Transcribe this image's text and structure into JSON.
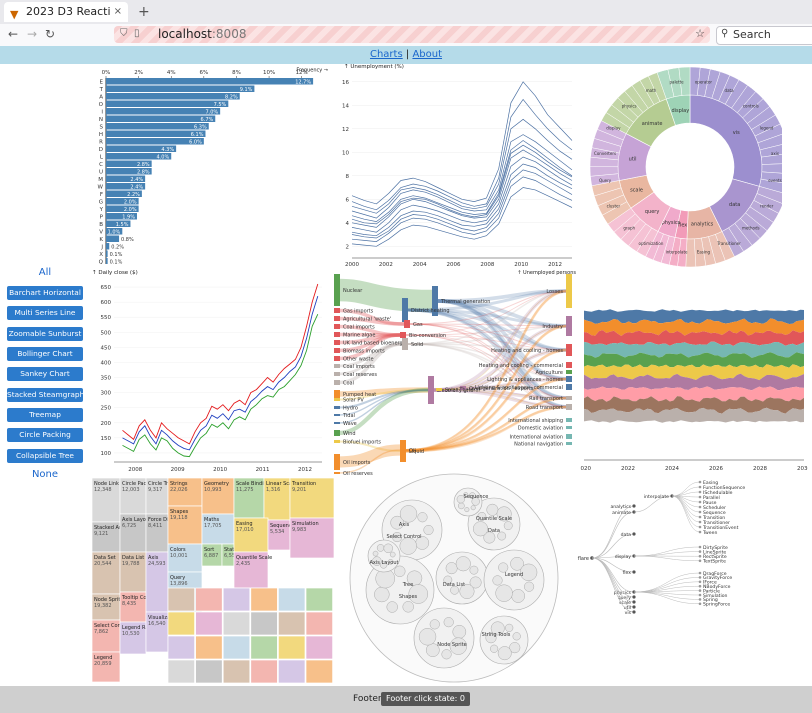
{
  "browser": {
    "tab_title": "2023 D3 Reactive",
    "tab_close": "×",
    "new_tab": "+",
    "url_host": "localhost",
    "url_port": ":8008",
    "search_placeholder": "Search",
    "back_glyph": "←",
    "forward_glyph": "→",
    "reload_glyph": "↻"
  },
  "topnav": {
    "charts_label": "Charts",
    "separator": "|",
    "about_label": "About"
  },
  "sidebar": {
    "all_label": "All",
    "none_label": "None",
    "buttons": [
      "Barchart Horizontal",
      "Multi Series Line",
      "Zoomable Sunburst",
      "Bollinger Chart",
      "Sankey Chart",
      "Stacked Steamgraph",
      "Treemap",
      "Circle Packing",
      "Collapsible Tree"
    ],
    "button_color": "#2c7bcc"
  },
  "footer": {
    "label": "Footer",
    "state_text": "Footer click state: 0"
  },
  "chart_data": [
    {
      "type": "bar",
      "title": "",
      "xlabel": "Frequency →",
      "categories": [
        "E",
        "T",
        "A",
        "O",
        "I",
        "N",
        "S",
        "H",
        "R",
        "D",
        "L",
        "C",
        "U",
        "M",
        "W",
        "F",
        "G",
        "Y",
        "P",
        "B",
        "V",
        "K",
        "J",
        "X",
        "Q",
        "Z"
      ],
      "values": [
        12.7,
        9.1,
        8.2,
        7.5,
        7.0,
        6.7,
        6.3,
        6.1,
        6.0,
        4.3,
        4.0,
        2.8,
        2.8,
        2.4,
        2.4,
        2.2,
        2.0,
        2.0,
        1.9,
        1.5,
        1.0,
        0.8,
        0.2,
        0.1,
        0.1,
        0.1
      ],
      "value_labels": [
        "12.7%",
        "9.1%",
        "8.2%",
        "7.5%",
        "7.0%",
        "6.7%",
        "6.3%",
        "6.1%",
        "6.0%",
        "4.3%",
        "4.0%",
        "2.8%",
        "2.8%",
        "2.4%",
        "2.4%",
        "2.2%",
        "2.0%",
        "2.0%",
        "1.9%",
        "1.5%",
        "1.0%",
        "0.8%",
        "0.2%",
        "0.1%",
        "0.1%",
        "0.1%"
      ],
      "xticks": [
        "0%",
        "2%",
        "4%",
        "6%",
        "8%",
        "10%",
        "12%"
      ],
      "xlim": [
        0,
        13
      ],
      "color": "#4682b4"
    },
    {
      "type": "line",
      "ylabel": "↑ Unemployment (%)",
      "xticks": [
        "2000",
        "2002",
        "2004",
        "2006",
        "2008",
        "2010",
        "2012"
      ],
      "yticks": [
        "2",
        "4",
        "6",
        "8",
        "10",
        "12",
        "14",
        "16"
      ],
      "xlim": [
        2000,
        2013
      ],
      "ylim": [
        1,
        17
      ],
      "color": "#1f4e8c",
      "series": [
        {
          "values": [
            4.0,
            3.8,
            3.6,
            4.5,
            5.6,
            6.0,
            5.8,
            5.4,
            5.0,
            4.6,
            4.4,
            4.5,
            6.0,
            9.5,
            10.2,
            9.6,
            8.9,
            8.2,
            7.6
          ]
        },
        {
          "values": [
            3.2,
            3.0,
            2.9,
            3.6,
            4.6,
            5.0,
            4.9,
            4.6,
            4.2,
            3.8,
            3.7,
            3.9,
            5.2,
            8.1,
            9.0,
            8.7,
            8.0,
            7.4,
            6.9
          ]
        },
        {
          "values": [
            5.0,
            4.7,
            4.4,
            5.3,
            6.5,
            6.8,
            6.6,
            6.2,
            5.7,
            5.2,
            5.0,
            5.1,
            6.8,
            10.9,
            11.5,
            10.9,
            10.1,
            9.3,
            8.5
          ]
        },
        {
          "values": [
            2.6,
            2.5,
            2.4,
            3.1,
            4.0,
            4.4,
            4.3,
            4.0,
            3.6,
            3.2,
            3.0,
            3.3,
            4.4,
            7.1,
            7.9,
            7.6,
            7.0,
            6.4,
            5.9
          ]
        },
        {
          "values": [
            4.6,
            4.3,
            4.1,
            4.9,
            6.0,
            6.3,
            6.1,
            5.7,
            5.3,
            4.9,
            4.7,
            4.8,
            6.5,
            10.2,
            11.0,
            10.3,
            9.5,
            8.7,
            8.0
          ]
        },
        {
          "values": [
            5.8,
            5.4,
            5.1,
            5.9,
            7.0,
            7.3,
            7.1,
            6.7,
            6.2,
            5.7,
            5.4,
            5.6,
            7.8,
            13.0,
            14.5,
            13.2,
            12.0,
            11.0,
            10.2
          ]
        },
        {
          "values": [
            3.6,
            3.4,
            3.2,
            4.0,
            5.1,
            5.5,
            5.3,
            5.0,
            4.6,
            4.2,
            4.0,
            4.2,
            5.6,
            8.8,
            9.6,
            9.2,
            8.5,
            7.8,
            7.2
          ]
        },
        {
          "values": [
            6.3,
            5.9,
            5.6,
            6.5,
            7.6,
            7.8,
            7.5,
            7.0,
            6.5,
            6.0,
            5.8,
            6.1,
            8.6,
            14.2,
            16.0,
            14.8,
            13.2,
            12.1,
            11.0
          ]
        },
        {
          "values": [
            2.2,
            2.1,
            2.0,
            2.6,
            3.4,
            3.8,
            3.7,
            3.4,
            3.1,
            2.8,
            2.6,
            2.9,
            3.9,
            6.2,
            7.0,
            6.8,
            6.3,
            5.8,
            5.3
          ]
        },
        {
          "values": [
            4.3,
            4.0,
            3.9,
            4.7,
            5.8,
            6.1,
            6.0,
            5.6,
            5.1,
            4.7,
            4.5,
            4.7,
            6.3,
            9.9,
            10.6,
            10.0,
            9.2,
            8.5,
            7.9
          ]
        },
        {
          "values": [
            3.0,
            2.8,
            2.7,
            3.3,
            4.3,
            4.7,
            4.6,
            4.3,
            3.9,
            3.5,
            3.3,
            3.6,
            4.8,
            7.6,
            8.5,
            8.2,
            7.6,
            7.0,
            6.4
          ]
        },
        {
          "values": [
            5.4,
            5.1,
            4.8,
            5.6,
            6.8,
            7.0,
            6.8,
            6.4,
            5.9,
            5.4,
            5.2,
            5.4,
            7.3,
            12.0,
            12.8,
            12.0,
            11.0,
            10.1,
            9.4
          ]
        }
      ]
    },
    {
      "type": "pie",
      "inner_labels": [
        "vis",
        "data",
        "analytics",
        "flex",
        "physics",
        "query",
        "scale",
        "util",
        "animate",
        "display"
      ],
      "inner_values": [
        22,
        10,
        6,
        2,
        3,
        6,
        5,
        8,
        9,
        4
      ],
      "inner_colors": [
        "#9c8fcf",
        "#a995cf",
        "#e7b5a5",
        "#f29bb8",
        "#f0aacb",
        "#f3b3ca",
        "#e9b7a0",
        "#c6a3d6",
        "#b5cc92",
        "#9ed3b6"
      ],
      "outer_labels": [
        "operator",
        "data",
        "controls",
        "legend",
        "axis",
        "events",
        "render",
        "methods",
        "Transitioner",
        "Easing",
        "interpolate",
        "optimization",
        "graph",
        "cluster",
        "Query",
        "Converters",
        "display",
        "physics",
        "math",
        "palette"
      ]
    },
    {
      "type": "line",
      "ylabel": "↑ Daily close ($)",
      "xticks": [
        "2008",
        "2009",
        "2010",
        "2011",
        "2012"
      ],
      "yticks": [
        "100",
        "150",
        "200",
        "250",
        "300",
        "350",
        "400",
        "450",
        "500",
        "550",
        "600",
        "650"
      ],
      "xlim": [
        2007.5,
        2012.4
      ],
      "ylim": [
        70,
        680
      ],
      "series": [
        {
          "name": "upper",
          "color": "#e41a1c",
          "values": [
            175,
            160,
            145,
            190,
            210,
            175,
            150,
            200,
            180,
            165,
            150,
            140,
            130,
            170,
            200,
            215,
            255,
            245,
            260,
            240,
            265,
            275,
            260,
            300,
            310,
            330,
            350,
            335,
            360,
            380,
            395,
            410,
            450,
            520,
            600,
            660
          ]
        },
        {
          "name": "close",
          "color": "#1f3fbf",
          "values": [
            150,
            140,
            130,
            170,
            190,
            155,
            130,
            175,
            160,
            140,
            125,
            115,
            110,
            145,
            175,
            190,
            225,
            215,
            230,
            210,
            240,
            245,
            235,
            270,
            285,
            305,
            320,
            310,
            335,
            350,
            370,
            385,
            420,
            480,
            560,
            620
          ]
        },
        {
          "name": "lower",
          "color": "#2ca02c",
          "values": [
            125,
            115,
            105,
            145,
            160,
            130,
            110,
            150,
            140,
            115,
            100,
            90,
            88,
            120,
            150,
            165,
            195,
            185,
            200,
            180,
            210,
            220,
            210,
            245,
            260,
            280,
            290,
            285,
            310,
            320,
            340,
            360,
            390,
            440,
            520,
            560
          ]
        }
      ]
    },
    {
      "type": "sankey",
      "ylabel": "↑ Unemployed persons",
      "left_nodes": [
        "Nuclear",
        "Gas imports",
        "Agricultural 'waste'",
        "Coal imports",
        "Marine algae",
        "UK land based bioenergy",
        "Biomass imports",
        "Other waste",
        "Coal imports",
        "Coal reserves",
        "Coal",
        "Pumped heat",
        "Solar PV",
        "Hydro",
        "Tidal",
        "Wave",
        "Wind",
        "Biofuel imports",
        "Oil imports",
        "Oil reserves"
      ],
      "middle_nodes": [
        "Thermal generation",
        "District heating",
        "Gas",
        "Bio-conversion",
        "Solid",
        "Electricity grid",
        "Over generation / exports",
        "Solar Thermal",
        "Liquid",
        "Oil"
      ],
      "right_nodes": [
        "Losses",
        "Industry",
        "Heating and cooling - homes",
        "Heating and cooling - commercial",
        "Agriculture",
        "Lighting & appliances - homes",
        "Lighting & appliances - commercial",
        "Rail transport",
        "Road transport",
        "International shipping",
        "Domestic aviation",
        "International aviation",
        "National navigation"
      ]
    },
    {
      "type": "area",
      "xticks": [
        "2020",
        "2022",
        "2024",
        "2026",
        "2028",
        "2030"
      ],
      "series_colors": [
        "#4e79a7",
        "#f28e2c",
        "#e15759",
        "#76b7b2",
        "#59a14f",
        "#edc949",
        "#af7aa1",
        "#ff9da7",
        "#9c755f",
        "#bab0ab"
      ]
    },
    {
      "type": "table",
      "title": "Treemap",
      "cells": [
        {
          "label": "Node Link Tree Layout",
          "value": "12,348"
        },
        {
          "label": "Circle Packing Layout",
          "value": "12,003"
        },
        {
          "label": "Circle Tree Layout",
          "value": "9,317"
        },
        {
          "label": "Stacked Area Layout",
          "value": "9,121"
        },
        {
          "label": "Axis Layout",
          "value": "6,725"
        },
        {
          "label": "Force Directed Layout",
          "value": "8,411"
        },
        {
          "label": "Data Set",
          "value": "20,544"
        },
        {
          "label": "Data List",
          "value": "19,788"
        },
        {
          "label": "Node Sprite",
          "value": "19,382"
        },
        {
          "label": "Tooltip Control",
          "value": "8,435"
        },
        {
          "label": "Select Control",
          "value": "7,862"
        },
        {
          "label": "Legend",
          "value": "20,859"
        },
        {
          "label": "Legend Range",
          "value": "10,530"
        },
        {
          "label": "Axis",
          "value": "24,593"
        },
        {
          "label": "Visualization",
          "value": "16,540"
        },
        {
          "label": "Strings",
          "value": "22,026"
        },
        {
          "label": "Shapes",
          "value": "19,118"
        },
        {
          "label": "Geometry",
          "value": "10,993"
        },
        {
          "label": "Colors",
          "value": "10,001"
        },
        {
          "label": "Query",
          "value": "13,896"
        },
        {
          "label": "Maths",
          "value": "17,705"
        },
        {
          "label": "Sort",
          "value": "6,887"
        },
        {
          "label": "Stats",
          "value": "6,557"
        },
        {
          "label": "Scale Binding",
          "value": "11,275"
        },
        {
          "label": "Linear Scale",
          "value": "1,316"
        },
        {
          "label": "Transition",
          "value": "9,201"
        },
        {
          "label": "Easing",
          "value": "17,010"
        },
        {
          "label": "Sequence",
          "value": "5,534"
        },
        {
          "label": "Simulation",
          "value": "9,983"
        },
        {
          "label": "Quantile Scale",
          "value": "2,435"
        }
      ],
      "colors": [
        "#d9d9d9",
        "#c7c7c7",
        "#d8c3b0",
        "#f3b6b0",
        "#d5c7e6",
        "#f7c08a",
        "#c7dbe8",
        "#b5d7a8",
        "#f2d97e",
        "#e6b7d6"
      ]
    },
    {
      "type": "scatter",
      "title": "Circle Packing",
      "labels": [
        "Axis",
        "Data",
        "Tree",
        "Data List",
        "Legend",
        "Node Sprite",
        "String Tools",
        "Axis Layout",
        "Sequence",
        "Select Control",
        "Quantile Scale",
        "Shapes"
      ]
    },
    {
      "type": "table",
      "title": "Collapsible Tree",
      "root": "flare",
      "branches": [
        "analytics",
        "animate",
        "data",
        "display",
        "flex",
        "physics",
        "query",
        "scale",
        "util",
        "vis"
      ],
      "interpolate_leaves": [
        "Easing",
        "FunctionSequence",
        "ISchedulable",
        "Parallel",
        "Pause",
        "Scheduler",
        "Sequence",
        "Transition",
        "Transitioner",
        "TransitionEvent",
        "Tween"
      ],
      "display_leaves": [
        "DirtySprite",
        "LineSprite",
        "RectSprite",
        "TextSprite"
      ],
      "physics_leaves": [
        "DragForce",
        "GravityForce",
        "IForce",
        "NBodyForce",
        "Particle",
        "Simulation",
        "Spring",
        "SpringForce"
      ],
      "other_node": "interpolate"
    }
  ]
}
